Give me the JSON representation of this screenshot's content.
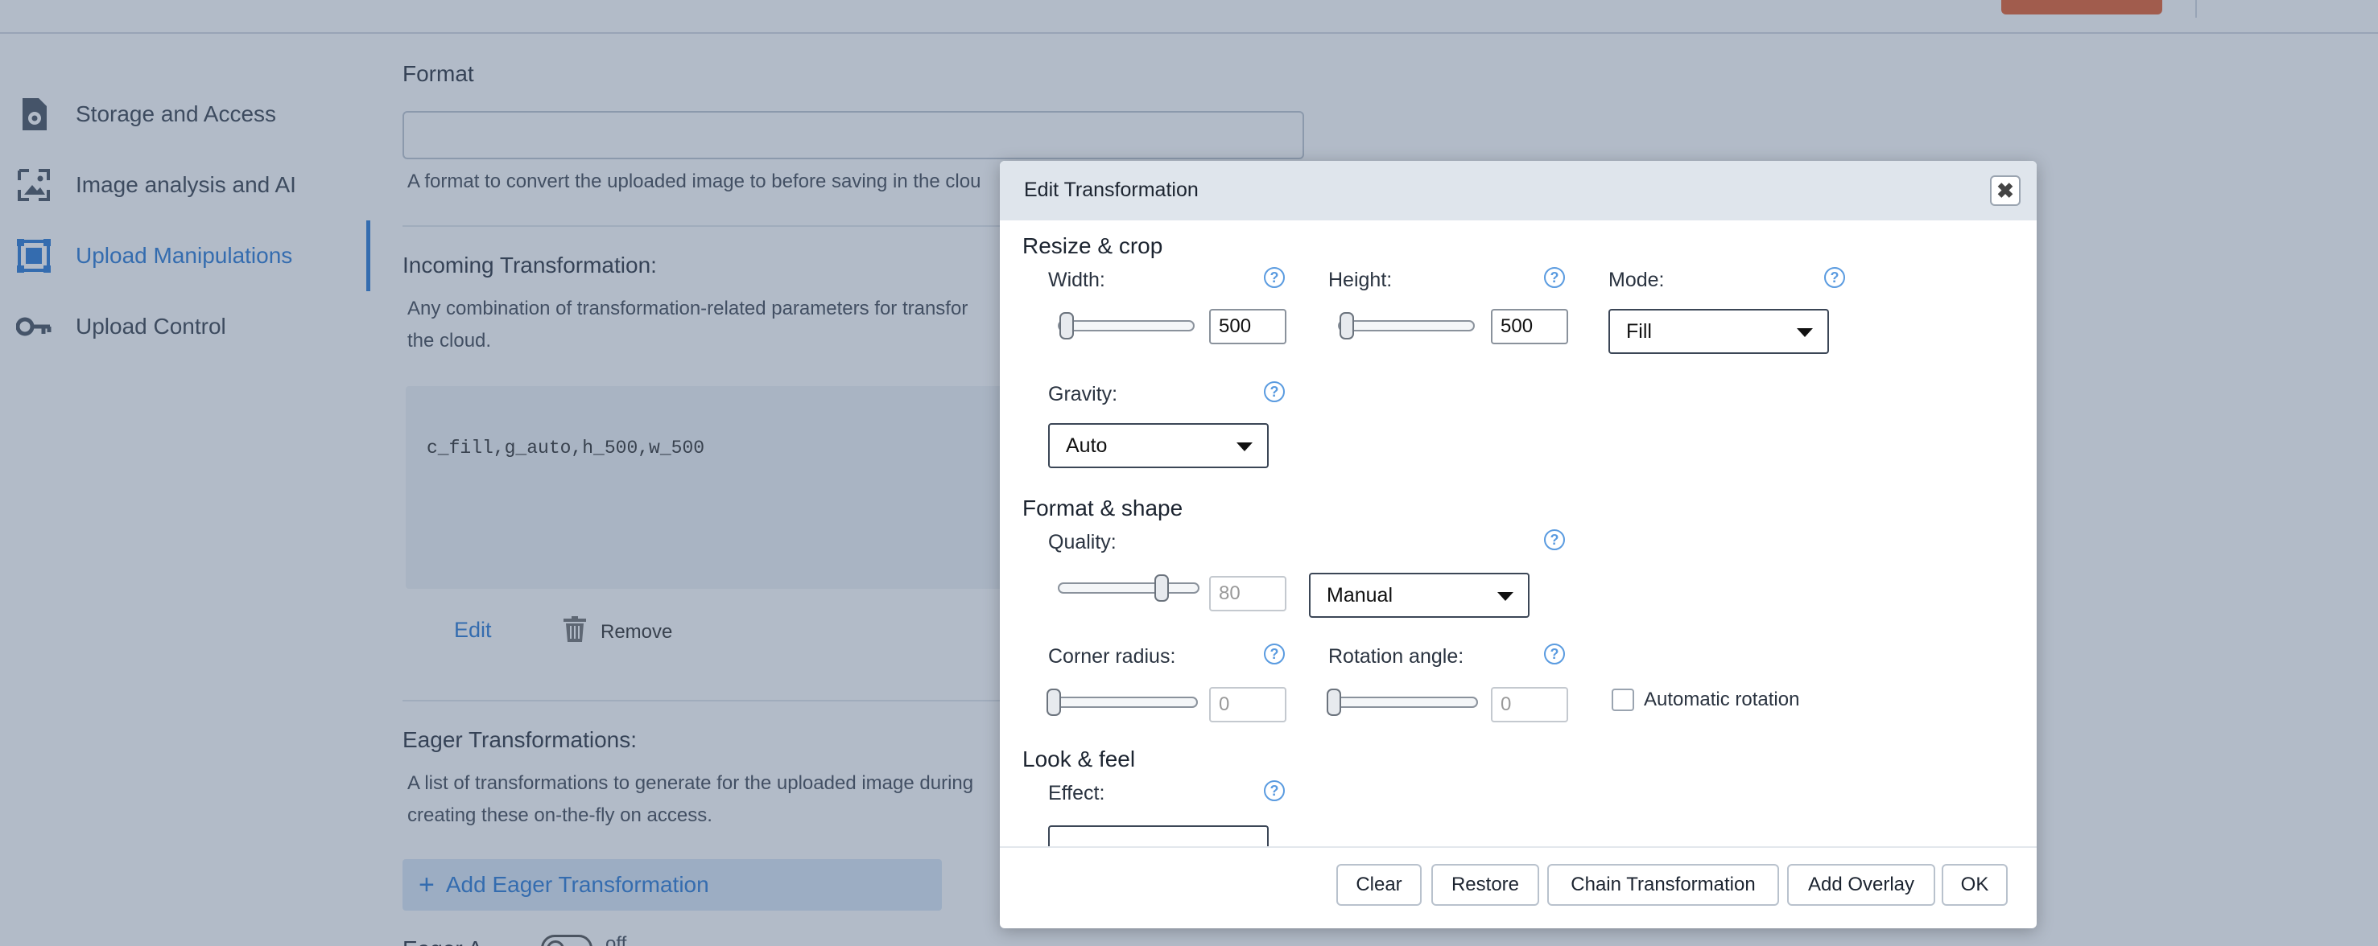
{
  "sidebar": {
    "items": [
      {
        "label": "Storage and Access",
        "icon": "gear-file-icon",
        "active": false
      },
      {
        "label": "Image analysis and AI",
        "icon": "image-frame-icon",
        "active": false
      },
      {
        "label": "Upload Manipulations",
        "icon": "crop-frame-icon",
        "active": true
      },
      {
        "label": "Upload Control",
        "icon": "key-icon",
        "active": false
      }
    ]
  },
  "main": {
    "format": {
      "title": "Format",
      "value": "",
      "description": "A format to convert the uploaded image to before saving in the clou"
    },
    "incoming": {
      "title": "Incoming Transformation:",
      "description_line1": "Any combination of transformation-related parameters for transfor",
      "description_line2": "the cloud.",
      "code": "c_fill,g_auto,h_500,w_500",
      "edit_label": "Edit",
      "remove_label": "Remove"
    },
    "eager": {
      "title": "Eager Transformations:",
      "description_line1": "A list of transformations to generate for the uploaded image during",
      "description_line2": "creating these on-the-fly on access.",
      "add_label": "Add Eager Transformation"
    },
    "eager_async": {
      "label": "Eager A",
      "state": "off"
    }
  },
  "modal": {
    "title": "Edit Transformation",
    "close_symbol": "✖",
    "help_symbol": "?",
    "resize_crop": {
      "title": "Resize & crop",
      "width_label": "Width:",
      "width_value": "500",
      "height_label": "Height:",
      "height_value": "500",
      "mode_label": "Mode:",
      "mode_value": "Fill",
      "gravity_label": "Gravity:",
      "gravity_value": "Auto"
    },
    "format_shape": {
      "title": "Format & shape",
      "quality_label": "Quality:",
      "quality_value": "80",
      "quality_mode": "Manual",
      "corner_label": "Corner radius:",
      "corner_value": "0",
      "rotation_label": "Rotation angle:",
      "rotation_value": "0",
      "auto_rotation_label": "Automatic rotation"
    },
    "look_feel": {
      "title": "Look & feel",
      "effect_label": "Effect:"
    },
    "buttons": {
      "clear": "Clear",
      "restore": "Restore",
      "chain": "Chain Transformation",
      "overlay": "Add Overlay",
      "ok": "OK"
    }
  }
}
